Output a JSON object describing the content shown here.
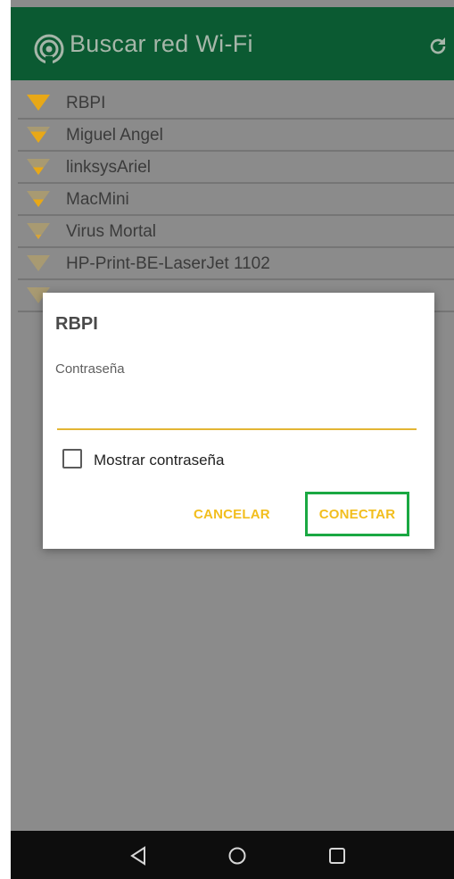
{
  "toolbar": {
    "title": "Buscar red Wi-Fi",
    "logo_icon": "wifi-scan-icon",
    "refresh_icon": "refresh-icon",
    "color": "#0b5a32"
  },
  "networks": [
    {
      "ssid": "RBPI",
      "signal": 4
    },
    {
      "ssid": "Miguel Angel",
      "signal": 3
    },
    {
      "ssid": "linksysAriel",
      "signal": 2
    },
    {
      "ssid": "MacMini",
      "signal": 2
    },
    {
      "ssid": "Virus Mortal",
      "signal": 1
    },
    {
      "ssid": "HP-Print-BE-LaserJet 1102",
      "signal": 1
    },
    {
      "ssid": "",
      "signal": 1
    }
  ],
  "dialog": {
    "title": "RBPI",
    "field_label": "Contraseña",
    "password_value": "",
    "show_password_label": "Mostrar contraseña",
    "show_password_checked": false,
    "cancel_label": "CANCELAR",
    "connect_label": "CONECTAR",
    "accent": "#f2be1e",
    "highlight": "#1aa842"
  },
  "navbar": {
    "back_icon": "back-triangle-icon",
    "home_icon": "home-circle-icon",
    "recents_icon": "recents-square-icon"
  }
}
